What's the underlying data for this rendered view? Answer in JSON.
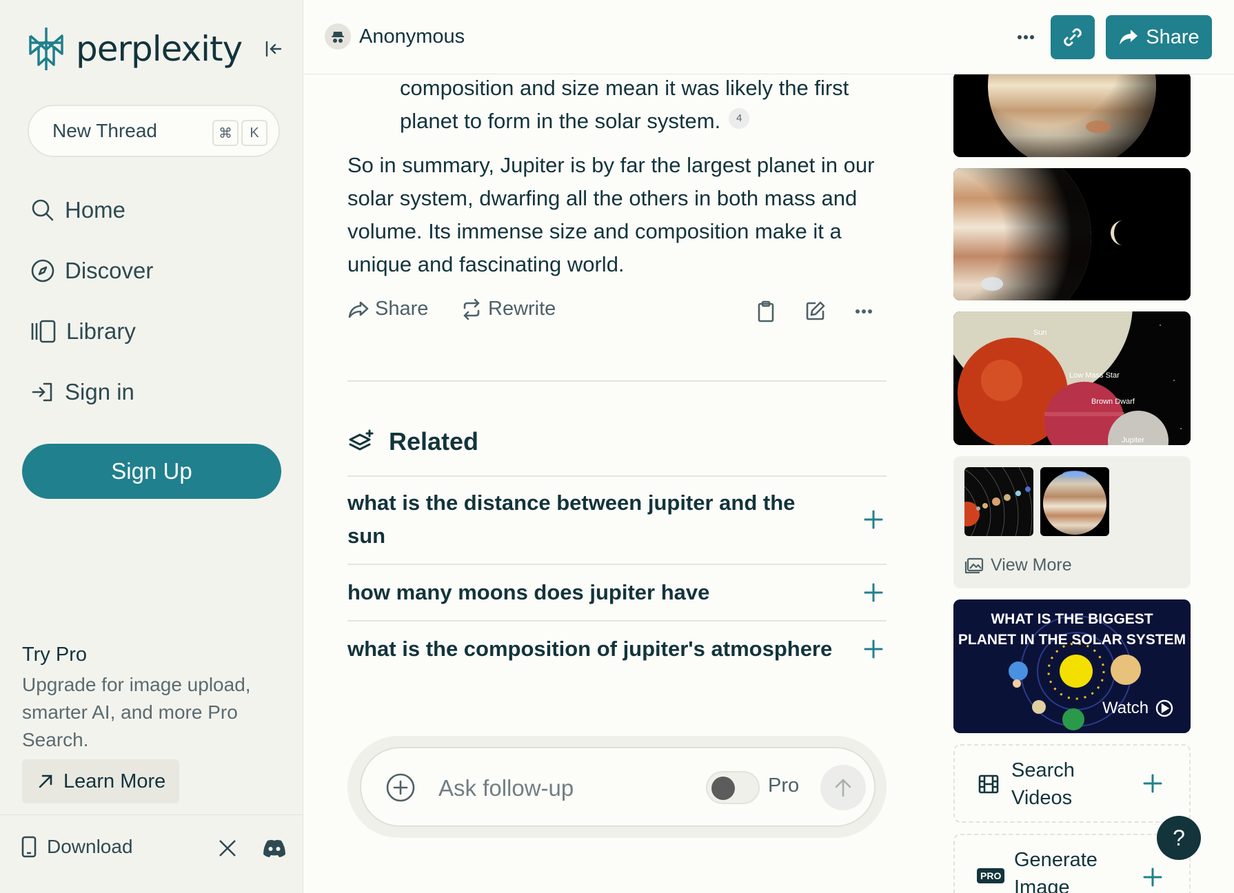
{
  "sidebar": {
    "logo_text": "perplexity",
    "new_thread": {
      "label": "New Thread",
      "kbd1": "⌘",
      "kbd2": "K"
    },
    "nav": {
      "home": "Home",
      "discover": "Discover",
      "library": "Library",
      "signin": "Sign in"
    },
    "signup": "Sign Up",
    "try_pro": {
      "title": "Try Pro",
      "description": "Upgrade for image upload, smarter AI, and more Pro Search.",
      "learn_more": "Learn More"
    },
    "footer": {
      "download": "Download"
    }
  },
  "topbar": {
    "user": "Anonymous",
    "share": "Share"
  },
  "answer": {
    "continuation": "composition and size mean it was likely the first planet to form in the solar system.",
    "citation": "4",
    "summary": "So in summary, Jupiter is by far the largest planet in our solar system, dwarfing all the others in both mass and volume. Its immense size and composition make it a unique and fascinating world.",
    "actions": {
      "share": "Share",
      "rewrite": "Rewrite"
    }
  },
  "related": {
    "heading": "Related",
    "items": [
      "what is the distance between jupiter and the sun",
      "how many moons does jupiter have",
      "what is the composition of jupiter's atmosphere"
    ]
  },
  "ask": {
    "placeholder": "Ask follow-up",
    "pro_label": "Pro",
    "pro_enabled": false
  },
  "right_panel": {
    "image3_labels": {
      "sun": "Sun",
      "low_mass_star": "Low Mass Star",
      "brown_dwarf": "Brown Dwarf",
      "jupiter": "Jupiter"
    },
    "view_more": "View More",
    "video": {
      "title_line1": "WHAT IS THE BIGGEST",
      "title_line2": "PLANET IN THE SOLAR SYSTEM",
      "watch": "Watch"
    },
    "search_videos": {
      "line1": "Search",
      "line2": "Videos"
    },
    "generate_image": {
      "line1": "Generate",
      "line2": "Image",
      "badge": "PRO"
    }
  },
  "help": "?",
  "colors": {
    "accent": "#20808d",
    "text": "#13343b",
    "sidebar_bg": "#f3f3ee",
    "page_bg": "#fcfcf9"
  }
}
